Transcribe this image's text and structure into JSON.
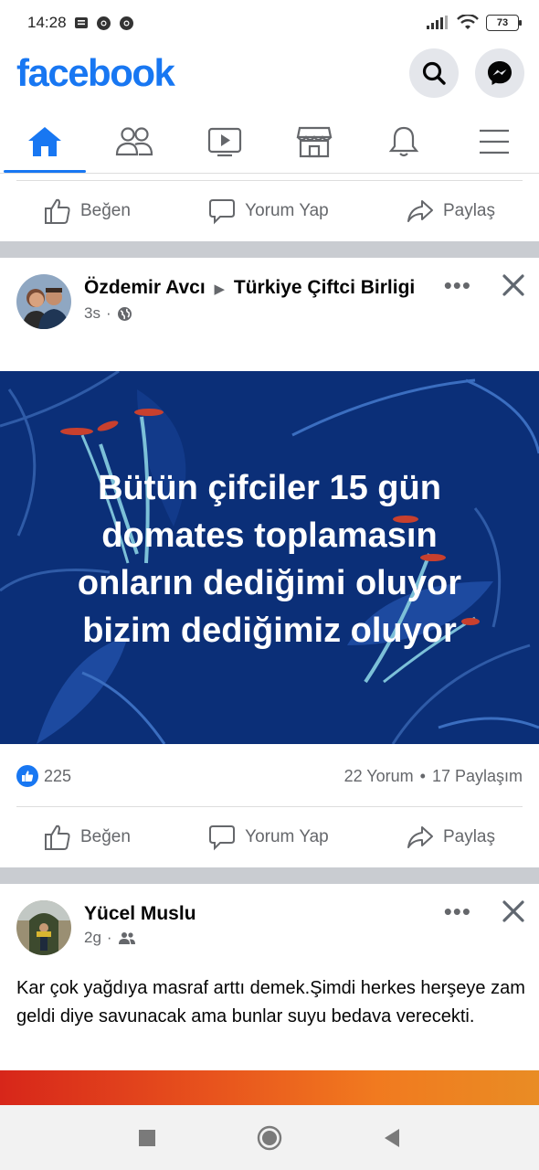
{
  "status_bar": {
    "time": "14:28",
    "battery": "73"
  },
  "header": {
    "logo": "facebook",
    "search_icon": "search-icon",
    "messenger_icon": "messenger-icon",
    "brand_color": "#1877f2"
  },
  "nav_tabs": [
    {
      "name": "home",
      "icon": "home-icon",
      "active": true
    },
    {
      "name": "friends",
      "icon": "friends-icon",
      "active": false
    },
    {
      "name": "watch",
      "icon": "video-icon",
      "active": false
    },
    {
      "name": "marketplace",
      "icon": "store-icon",
      "active": false
    },
    {
      "name": "notifications",
      "icon": "bell-icon",
      "active": false
    },
    {
      "name": "menu",
      "icon": "menu-icon",
      "active": false
    }
  ],
  "actions": {
    "like": "Beğen",
    "comment": "Yorum Yap",
    "share": "Paylaş"
  },
  "post1": {
    "author": "Özdemir Avcı",
    "group": "Türkiye Çiftci Birligi",
    "time": "3s",
    "more": "•••",
    "image_text": [
      "Bütün çifciler 15 gün",
      "domates toplamasın",
      "onların dediğimi oluyor",
      "bizim dediğimiz oluyor"
    ],
    "like_count": "225",
    "comments": "22 Yorum",
    "dot": "•",
    "shares": "17 Paylaşım"
  },
  "post2": {
    "author": "Yücel Muslu",
    "time": "2g",
    "more": "•••",
    "text": "Kar çok yağdıya masraf arttı demek.Şimdi herkes herşeye zam geldi diye savunacak ama bunlar suyu bedava verecekti."
  }
}
